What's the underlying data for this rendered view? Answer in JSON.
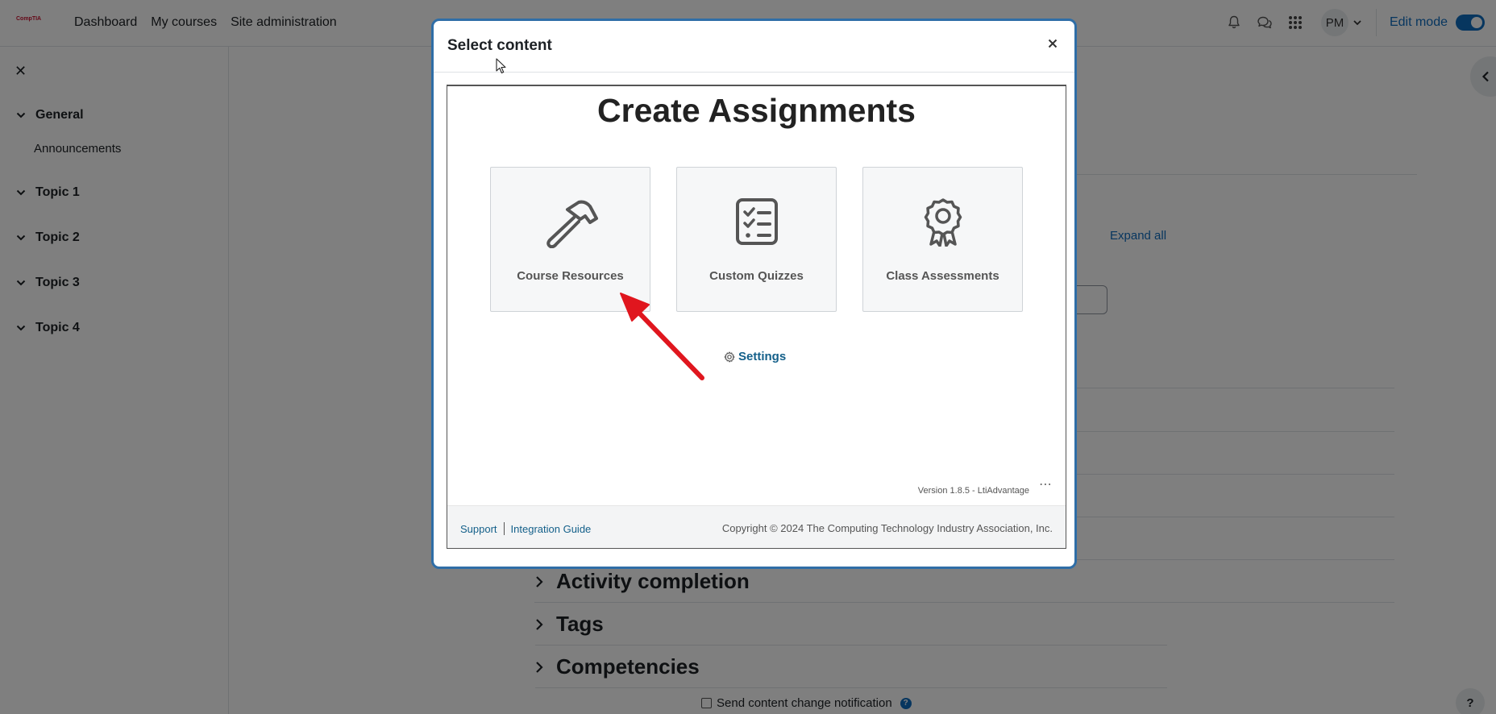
{
  "navbar": {
    "logo_text": "CompTIA",
    "links": [
      "Dashboard",
      "My courses",
      "Site administration"
    ],
    "avatar_initials": "PM",
    "edit_mode_label": "Edit mode",
    "edit_mode_on": true
  },
  "drawer": {
    "close_symbol": "✕",
    "sections": [
      {
        "title": "General",
        "items": [
          "Announcements"
        ]
      },
      {
        "title": "Topic 1",
        "items": []
      },
      {
        "title": "Topic 2",
        "items": []
      },
      {
        "title": "Topic 3",
        "items": []
      },
      {
        "title": "Topic 4",
        "items": []
      }
    ]
  },
  "main": {
    "expand_all": "Expand all",
    "sections": [
      "Activity completion",
      "Tags",
      "Competencies"
    ],
    "notification_label": "Send content change notification",
    "help_symbol": "?",
    "floating_help": "?"
  },
  "modal": {
    "title": "Select content",
    "close_symbol": "×",
    "heading": "Create Assignments",
    "cards": [
      {
        "label": "Course Resources",
        "icon": "hammer-icon"
      },
      {
        "label": "Custom Quizzes",
        "icon": "checklist-icon"
      },
      {
        "label": "Class Assessments",
        "icon": "award-icon"
      }
    ],
    "settings_label": "Settings",
    "version": "Version 1.8.5 - LtiAdvantage",
    "more_symbol": "⋯",
    "footer": {
      "support": "Support",
      "integration_guide": "Integration Guide",
      "copyright": "Copyright © 2024 The Computing Technology Industry Association, Inc."
    }
  },
  "colors": {
    "accent": "#0f6cbf",
    "modal_border": "#2f6ea7",
    "link": "#14608a",
    "annotation_arrow": "#e0161e"
  }
}
